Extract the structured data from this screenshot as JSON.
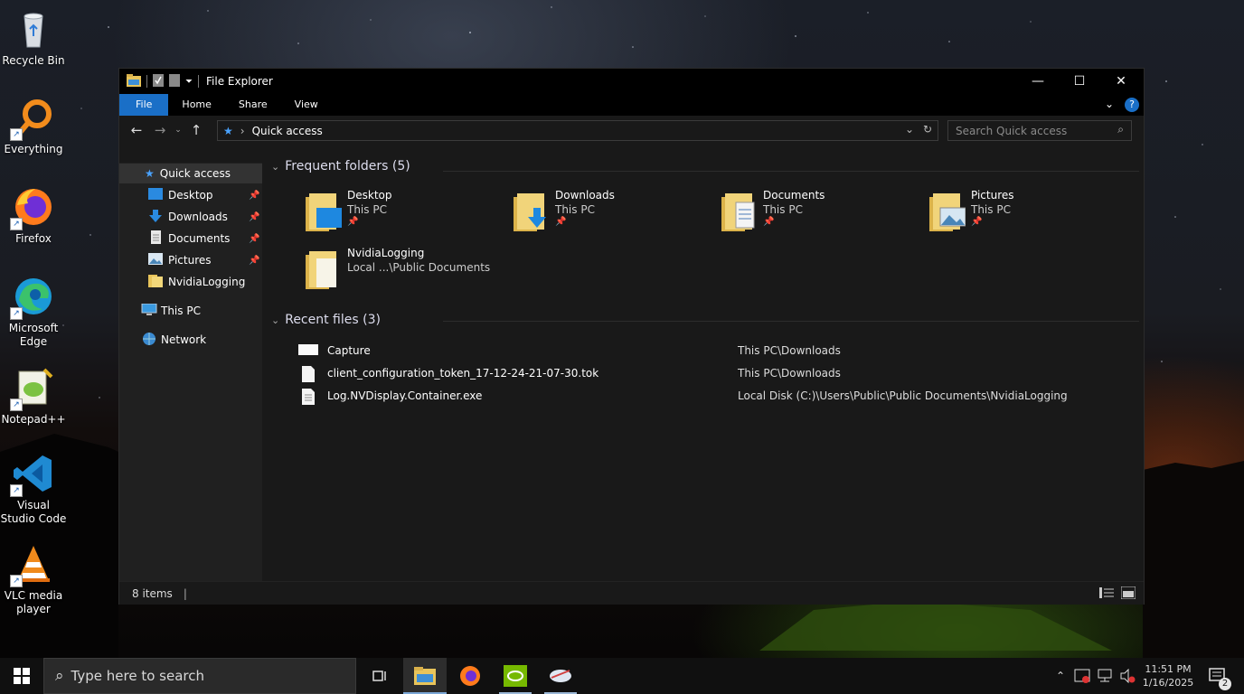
{
  "desktop": {
    "icons": [
      {
        "label": "Recycle Bin"
      },
      {
        "label": "Everything"
      },
      {
        "label": "Firefox"
      },
      {
        "label": "Microsoft Edge"
      },
      {
        "label": "Notepad++"
      },
      {
        "label": "Visual Studio Code"
      },
      {
        "label": "VLC media player"
      }
    ]
  },
  "window": {
    "title": "File Explorer",
    "ribbon_tabs": [
      "File",
      "Home",
      "Share",
      "View"
    ],
    "address": {
      "path": "Quick access"
    },
    "search": {
      "placeholder": "Search Quick access"
    },
    "nav": {
      "quick_access": "Quick access",
      "items": [
        {
          "label": "Desktop",
          "pinned": true
        },
        {
          "label": "Downloads",
          "pinned": true
        },
        {
          "label": "Documents",
          "pinned": true
        },
        {
          "label": "Pictures",
          "pinned": true
        },
        {
          "label": "NvidiaLogging",
          "pinned": false
        }
      ],
      "this_pc": "This PC",
      "network": "Network"
    },
    "frequent": {
      "title": "Frequent folders (5)",
      "folders": [
        {
          "name": "Desktop",
          "location": "This PC",
          "icon": "desktop-folder-icon"
        },
        {
          "name": "Downloads",
          "location": "This PC",
          "icon": "downloads-folder-icon"
        },
        {
          "name": "Documents",
          "location": "This PC",
          "icon": "documents-folder-icon"
        },
        {
          "name": "Pictures",
          "location": "This PC",
          "icon": "pictures-folder-icon"
        },
        {
          "name": "NvidiaLogging",
          "location": "Local ...\\Public Documents",
          "icon": "folder-icon"
        }
      ]
    },
    "recent": {
      "title": "Recent files (3)",
      "files": [
        {
          "name": "Capture",
          "location": "This PC\\Downloads"
        },
        {
          "name": "client_configuration_token_17-12-24-21-07-30.tok",
          "location": "This PC\\Downloads"
        },
        {
          "name": "Log.NVDisplay.Container.exe",
          "location": "Local Disk (C:)\\Users\\Public\\Public Documents\\NvidiaLogging"
        }
      ]
    },
    "status": {
      "items": "8 items"
    }
  },
  "taskbar": {
    "search_placeholder": "Type here to search",
    "time": "11:51 PM",
    "date": "1/16/2025",
    "notifications": "2"
  },
  "colors": {
    "accent": "#1a6fc7",
    "window_bg": "#191919",
    "nav_bg": "#202020"
  }
}
